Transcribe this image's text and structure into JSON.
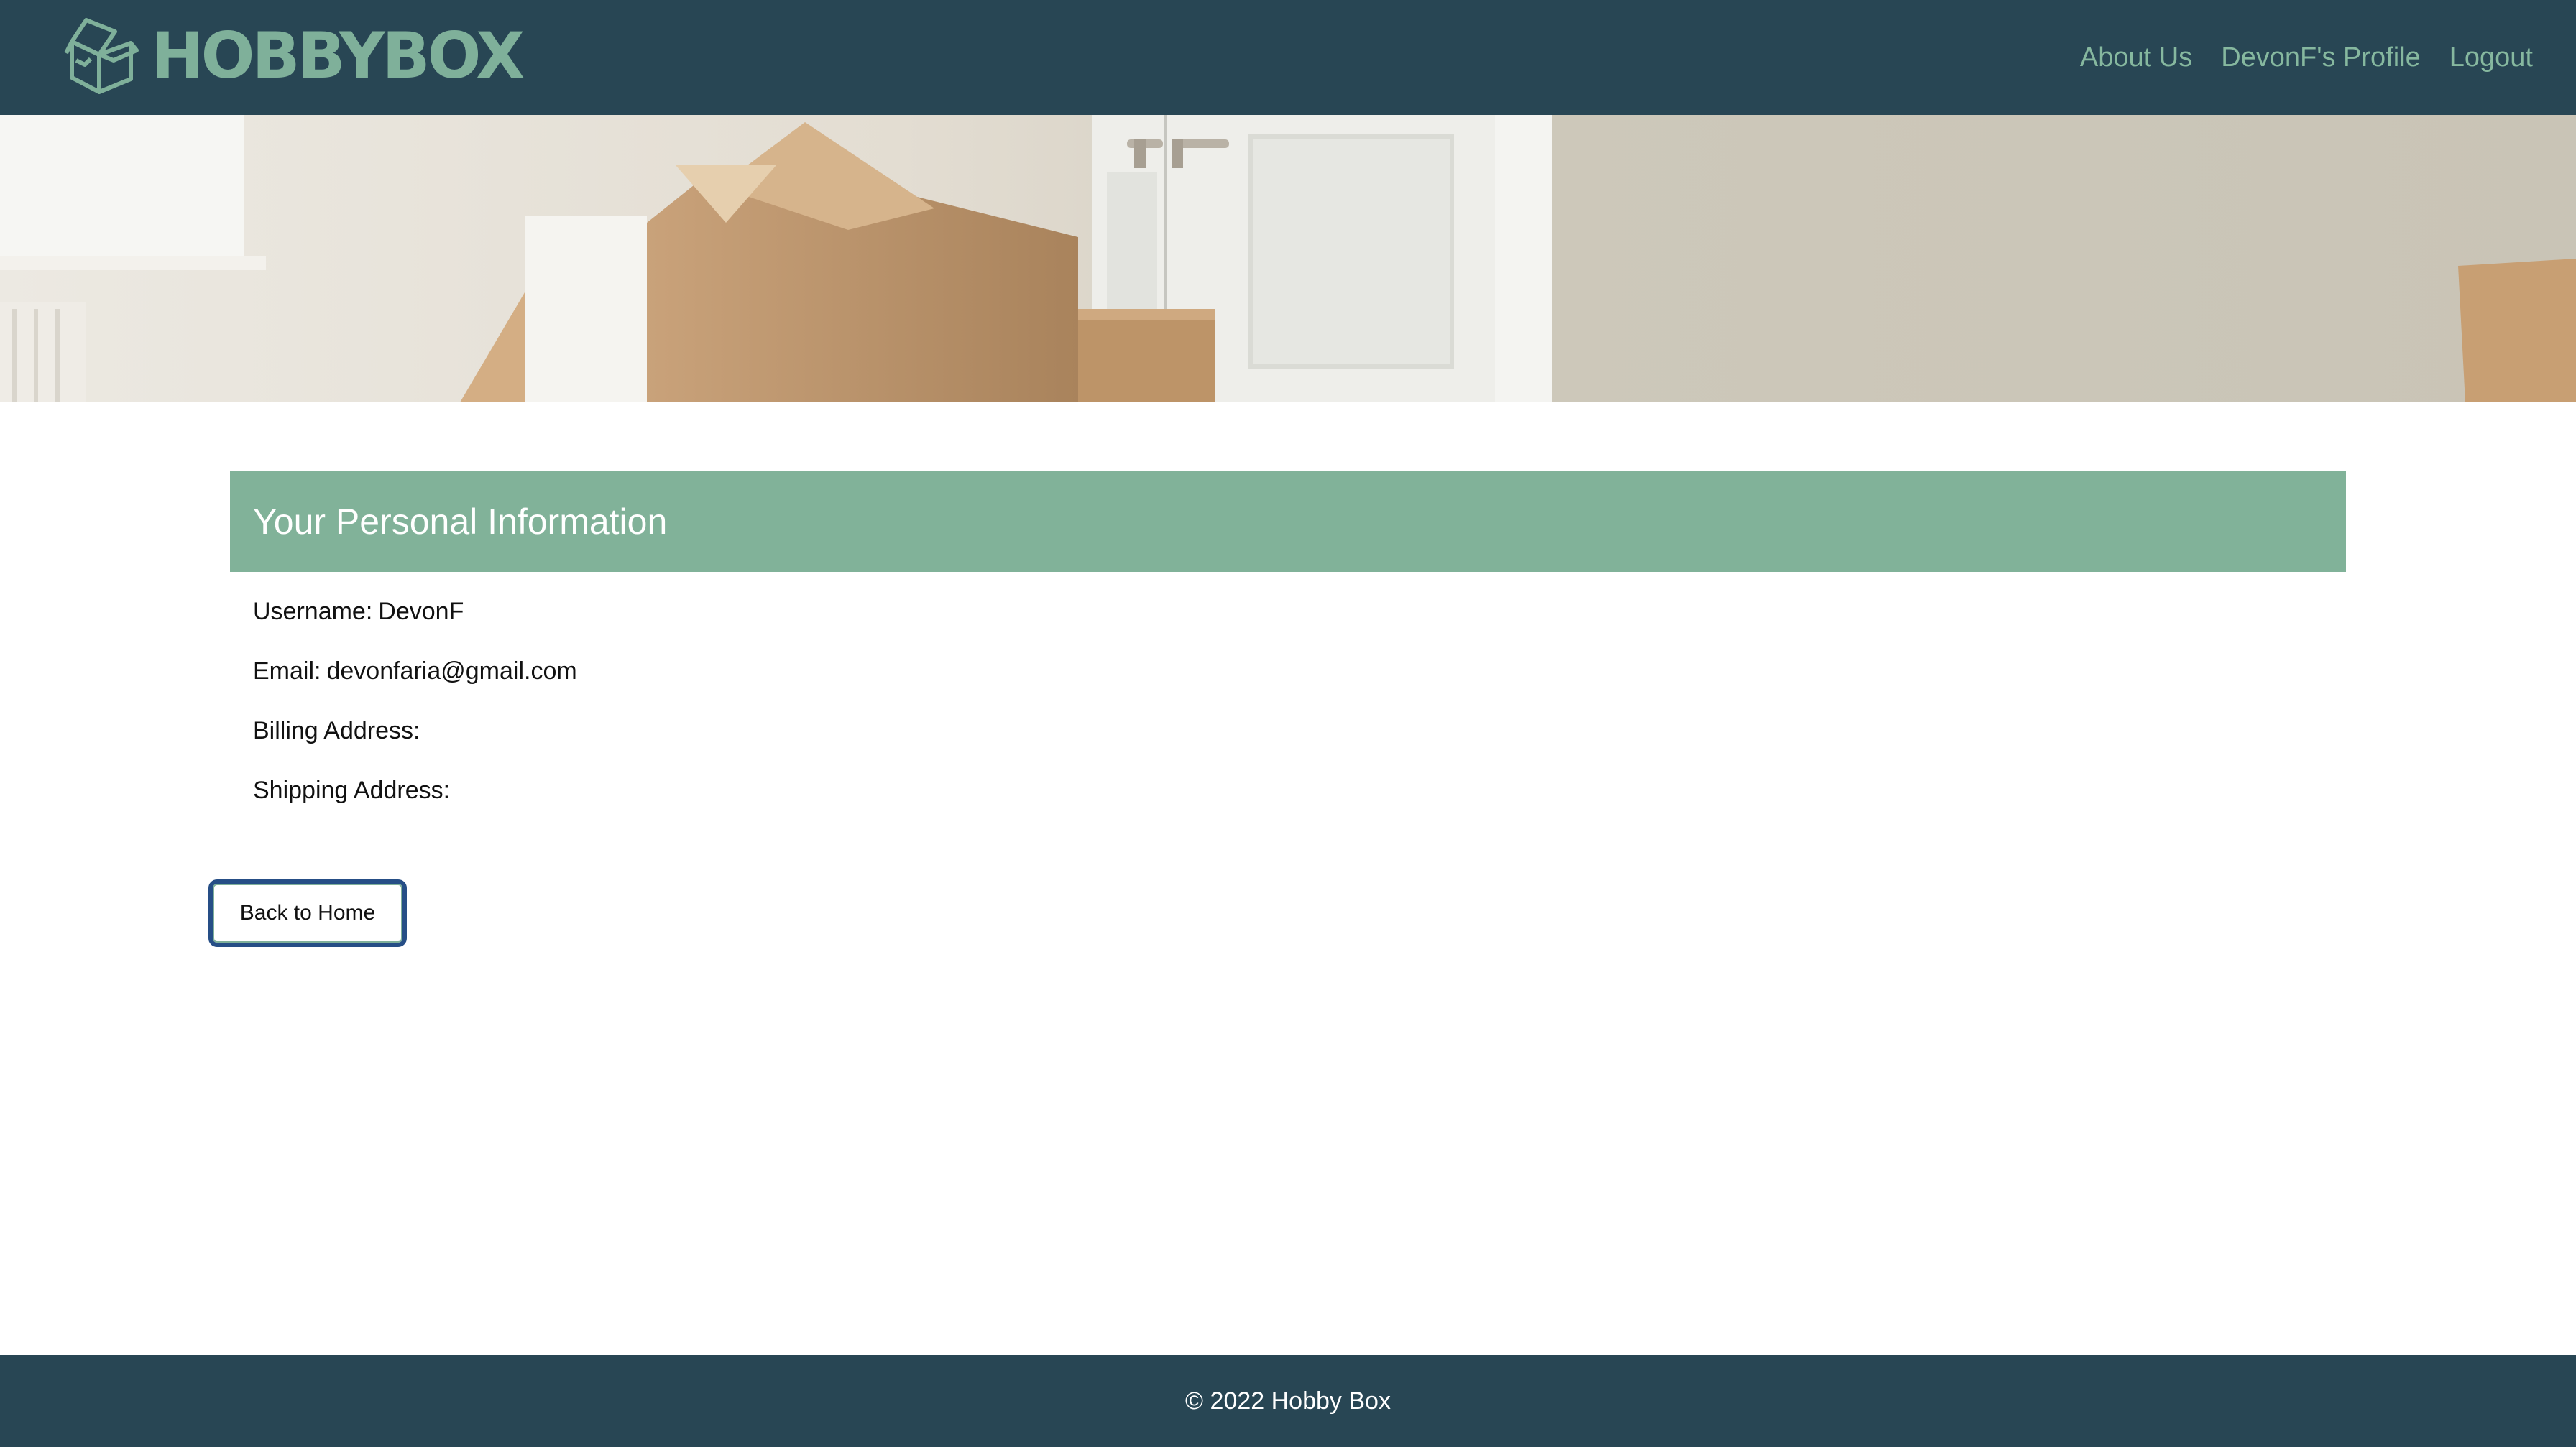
{
  "header": {
    "logo_text": "HOBBYBOX",
    "nav": [
      {
        "label": "About Us"
      },
      {
        "label": "DevonF's Profile"
      },
      {
        "label": "Logout"
      }
    ]
  },
  "personal_info": {
    "title": "Your Personal Information",
    "fields": [
      {
        "label": "Username:",
        "value": "DevonF"
      },
      {
        "label": "Email:",
        "value": "devonfaria@gmail.com"
      },
      {
        "label": "Billing Address:",
        "value": ""
      },
      {
        "label": "Shipping Address:",
        "value": ""
      }
    ],
    "back_button": "Back to Home"
  },
  "footer": {
    "copyright": "© 2022 Hobby Box"
  },
  "colors": {
    "header_bg": "#284654",
    "accent_green": "#81b299",
    "nav_text": "#86b89f",
    "button_border": "#264e86"
  }
}
